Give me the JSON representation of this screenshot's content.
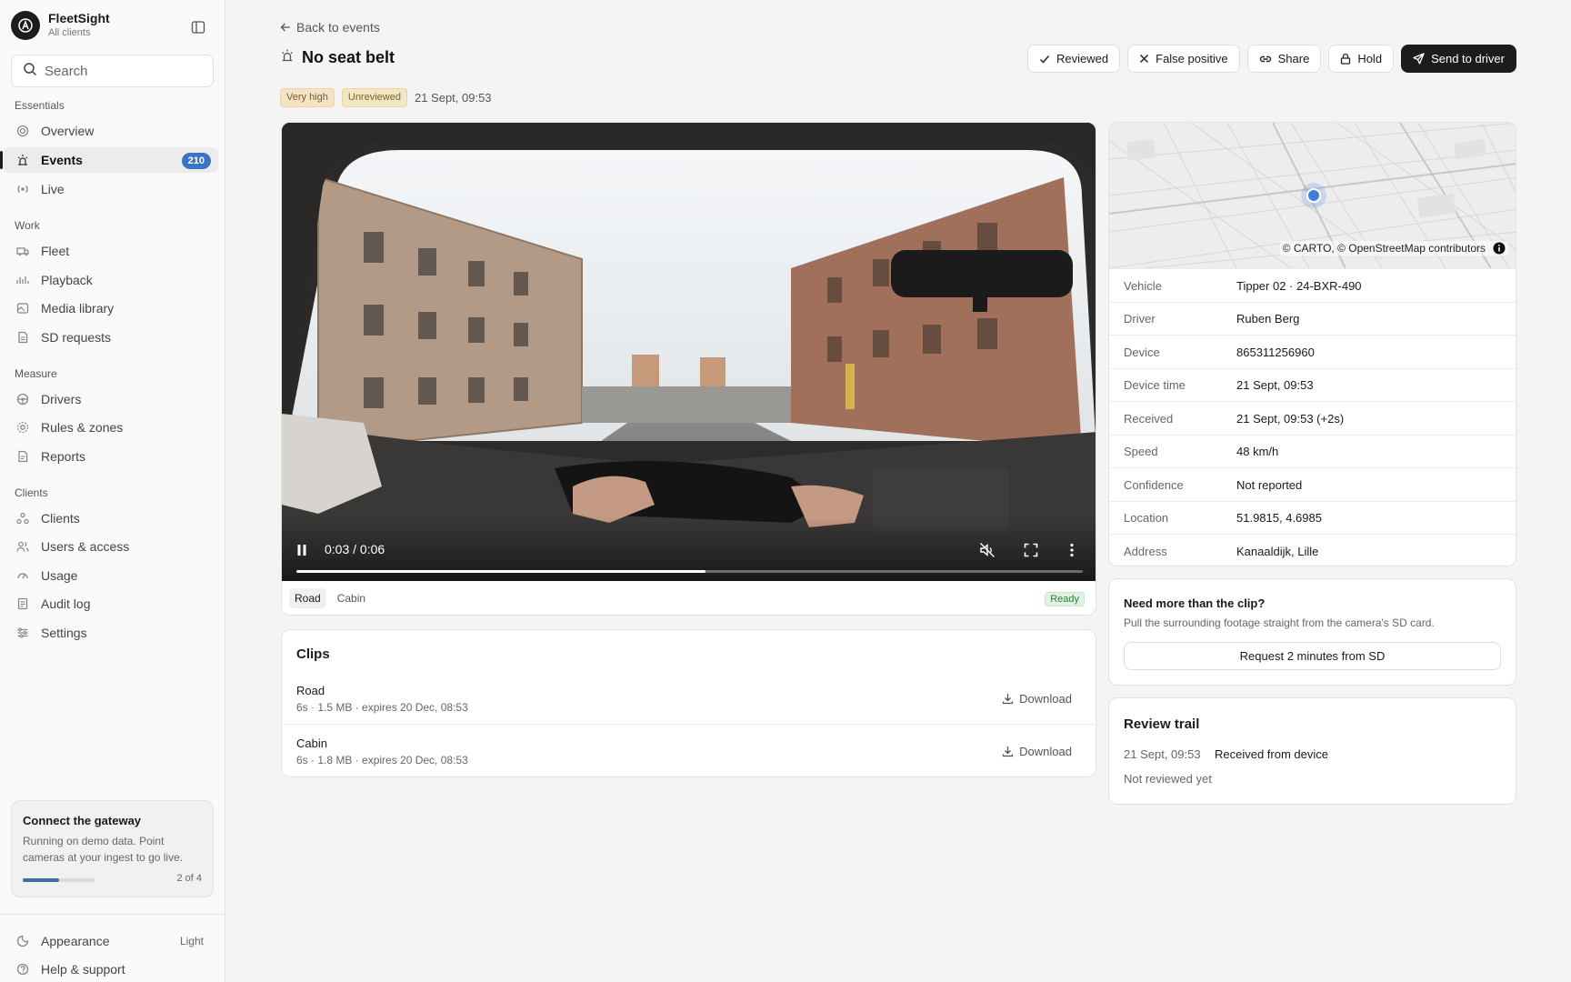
{
  "brand": {
    "name": "FleetSight",
    "subtitle": "All clients"
  },
  "search": {
    "placeholder": "Search"
  },
  "sidebar": {
    "sections": [
      {
        "label": "Essentials",
        "items": [
          {
            "label": "Overview",
            "icon": "overview-icon"
          },
          {
            "label": "Events",
            "icon": "events-icon",
            "badge": "210",
            "active": true
          },
          {
            "label": "Live",
            "icon": "live-icon"
          }
        ]
      },
      {
        "label": "Work",
        "items": [
          {
            "label": "Fleet",
            "icon": "truck-icon"
          },
          {
            "label": "Playback",
            "icon": "playback-icon"
          },
          {
            "label": "Media library",
            "icon": "media-icon"
          },
          {
            "label": "SD requests",
            "icon": "sd-card-icon"
          }
        ]
      },
      {
        "label": "Measure",
        "items": [
          {
            "label": "Drivers",
            "icon": "driver-icon"
          },
          {
            "label": "Rules & zones",
            "icon": "rules-icon"
          },
          {
            "label": "Reports",
            "icon": "reports-icon"
          }
        ]
      },
      {
        "label": "Clients",
        "items": [
          {
            "label": "Clients",
            "icon": "clients-icon"
          },
          {
            "label": "Users & access",
            "icon": "users-icon"
          },
          {
            "label": "Usage",
            "icon": "usage-icon"
          },
          {
            "label": "Audit log",
            "icon": "audit-icon"
          },
          {
            "label": "Settings",
            "icon": "settings-icon"
          }
        ]
      }
    ],
    "gateway": {
      "title": "Connect the gateway",
      "text": "Running on demo data. Point cameras at your ingest to go live.",
      "progress_text": "2 of 4",
      "progress_fraction": 0.5
    },
    "appearance": {
      "label": "Appearance",
      "value": "Light"
    },
    "help": {
      "label": "Help & support"
    }
  },
  "event": {
    "back_label": "Back to events",
    "title": "No seat belt",
    "severity": "Very high",
    "status": "Unreviewed",
    "time": "21 Sept, 09:53",
    "actions": {
      "reviewed": "Reviewed",
      "false_positive": "False positive",
      "share": "Share",
      "hold": "Hold",
      "send": "Send to driver"
    }
  },
  "video": {
    "time": "0:03 / 0:06",
    "progress_fraction": 0.52,
    "tabs": [
      "Road",
      "Cabin"
    ],
    "active_tab": "Road",
    "status": "Ready"
  },
  "clips": {
    "title": "Clips",
    "download_label": "Download",
    "items": [
      {
        "name": "Road",
        "meta": "6s · 1.5 MB · expires 20 Dec, 08:53"
      },
      {
        "name": "Cabin",
        "meta": "6s · 1.8 MB · expires 20 Dec, 08:53"
      }
    ]
  },
  "map": {
    "attribution": "© CARTO, © OpenStreetMap contributors"
  },
  "details": [
    {
      "key": "Vehicle",
      "value": "Tipper 02 · 24-BXR-490"
    },
    {
      "key": "Driver",
      "value": "Ruben Berg"
    },
    {
      "key": "Device",
      "value": "865311256960"
    },
    {
      "key": "Device time",
      "value": "21 Sept, 09:53"
    },
    {
      "key": "Received",
      "value": "21 Sept, 09:53 (+2s)"
    },
    {
      "key": "Speed",
      "value": "48 km/h"
    },
    {
      "key": "Confidence",
      "value": "Not reported"
    },
    {
      "key": "Location",
      "value": "51.9815, 4.6985"
    },
    {
      "key": "Address",
      "value": "Kanaaldijk, Lille"
    }
  ],
  "sd_request": {
    "title": "Need more than the clip?",
    "text": "Pull the surrounding footage straight from the camera's SD card.",
    "button": "Request 2 minutes from SD"
  },
  "review_trail": {
    "title": "Review trail",
    "entries": [
      {
        "time": "21 Sept, 09:53",
        "event": "Received from device"
      }
    ],
    "status": "Not reviewed yet"
  },
  "colors": {
    "accent": "#3b74c4",
    "primary_button": "#1c1c1c",
    "map_marker": "#3f7fd9"
  }
}
